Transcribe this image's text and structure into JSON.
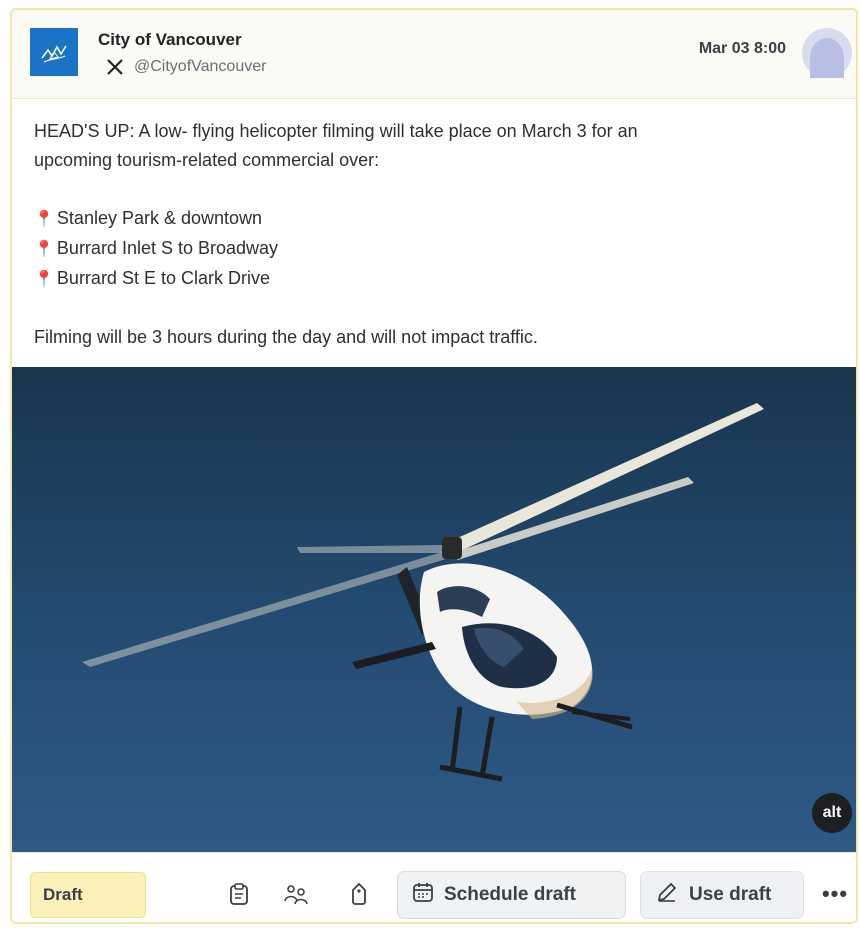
{
  "post": {
    "account_name": "City of Vancouver",
    "handle": "@CityofVancouver",
    "platform_icon": "x-logo-icon",
    "timestamp": "Mar 03 8:00",
    "text_line1": "HEAD'S UP: A low- flying helicopter filming will take place on March 3 for an",
    "text_line2": "upcoming tourism-related commercial over:",
    "locations": [
      "Stanley Park & downtown",
      "Burrard Inlet S to Broadway",
      "Burrard St E to Clark Drive"
    ],
    "closing": "Filming will be 3 hours during the day and will not impact traffic.",
    "pin_icon": "📍",
    "media_alt_label": "alt"
  },
  "footer": {
    "status": "Draft",
    "icons": [
      "clipboard-icon",
      "people-icon",
      "tag-icon"
    ],
    "schedule_label": "Schedule draft",
    "use_label": "Use draft",
    "more_label": "•••"
  },
  "colors": {
    "accent_yellow": "#fbf1b8",
    "logo_blue": "#1b73c7",
    "sky": "#244c73"
  }
}
